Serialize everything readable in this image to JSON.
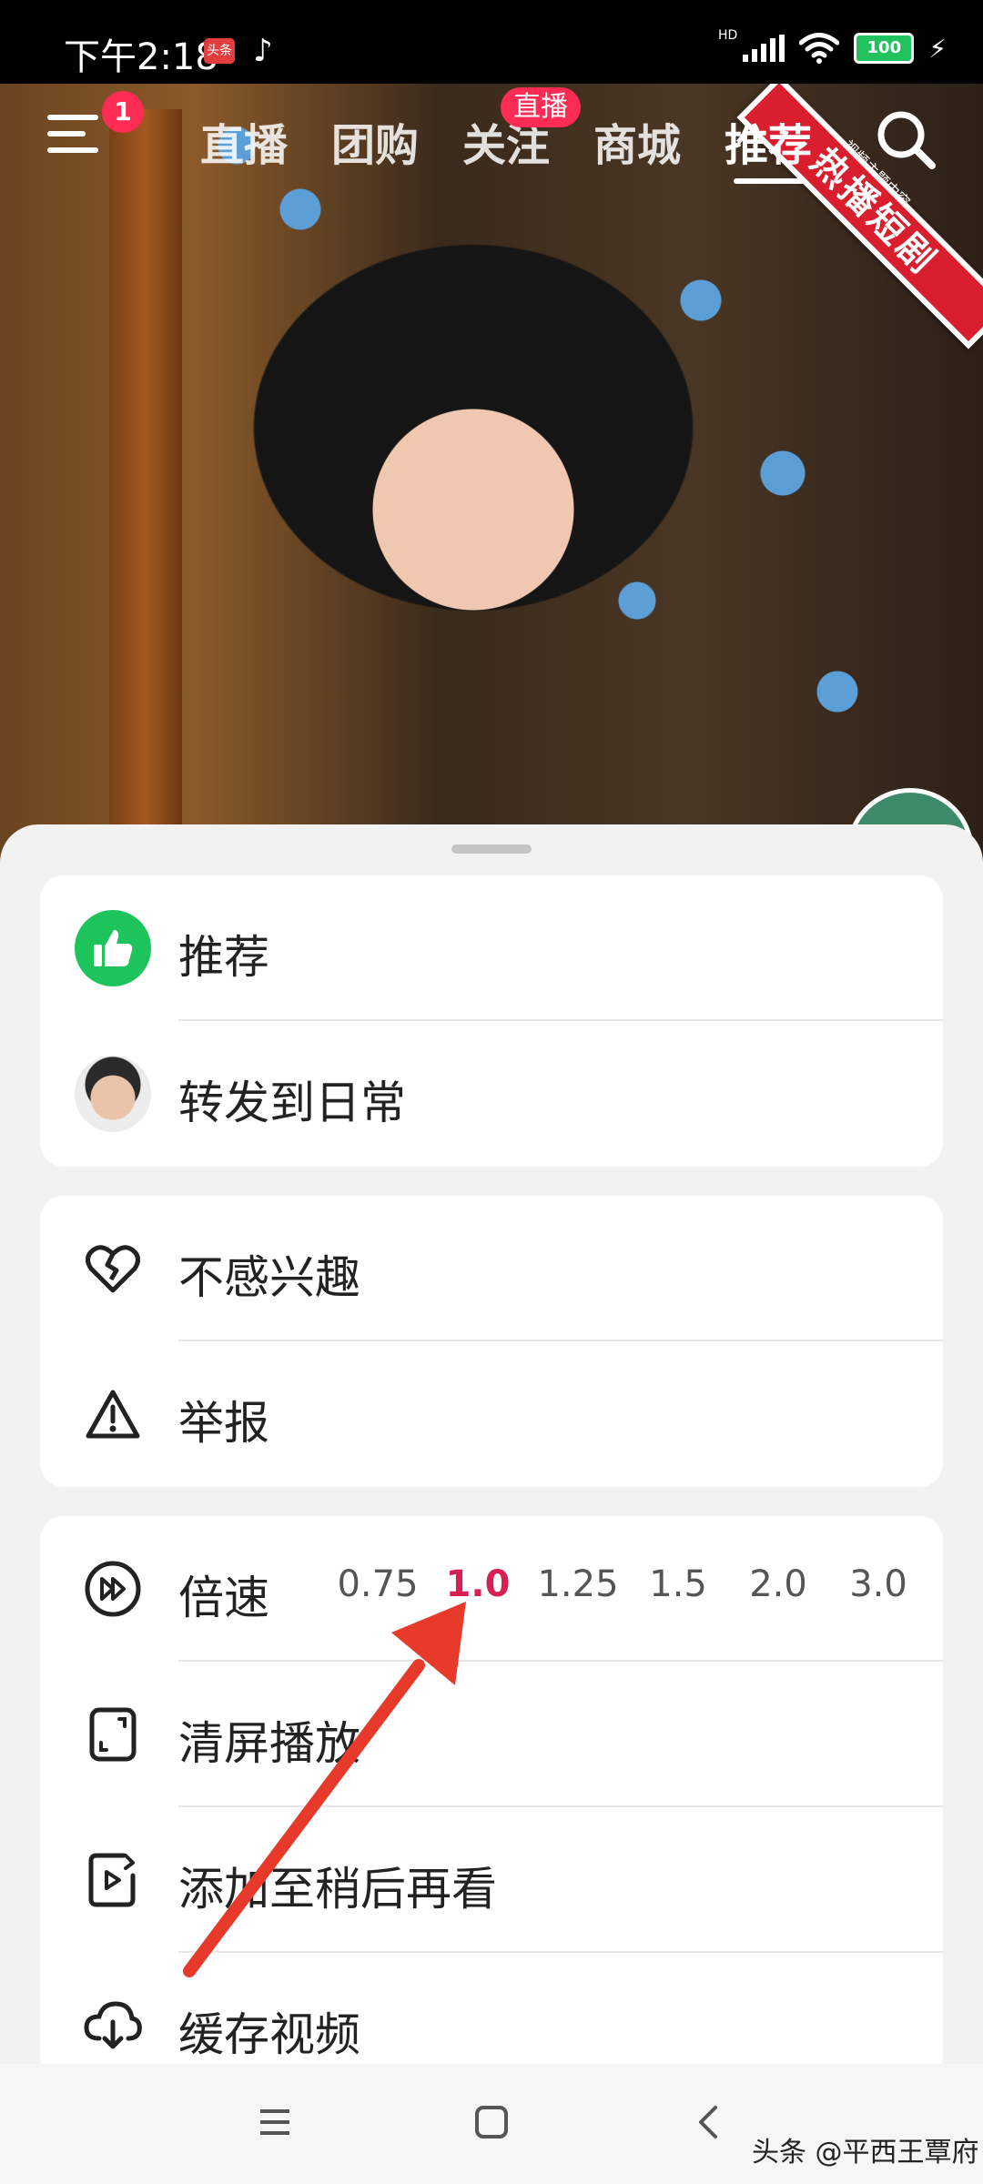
{
  "status_bar": {
    "time": "下午2:18",
    "app_badge": "头条",
    "network": "HD",
    "battery": "100"
  },
  "top_nav": {
    "notification_count": "1",
    "tabs": [
      {
        "label": "直播"
      },
      {
        "label": "团购"
      },
      {
        "label": "关注"
      },
      {
        "label": "商城"
      },
      {
        "label": "推荐"
      }
    ],
    "active_tab": "推荐",
    "live_badge": "直播"
  },
  "video": {
    "ribbon_text": "热播短剧",
    "ribbon_subtext": "- 视频主题内容 -"
  },
  "sheet": {
    "group1": [
      {
        "label": "推荐",
        "icon": "thumbs-up-icon"
      },
      {
        "label": "转发到日常",
        "icon": "avatar"
      }
    ],
    "group2": [
      {
        "label": "不感兴趣",
        "icon": "broken-heart-icon"
      },
      {
        "label": "举报",
        "icon": "warning-icon"
      }
    ],
    "group3": {
      "speed_label": "倍速",
      "speeds": [
        "0.75",
        "1.0",
        "1.25",
        "1.5",
        "2.0",
        "3.0"
      ],
      "selected_speed": "1.0",
      "items": [
        {
          "label": "清屏播放",
          "icon": "clear-screen-icon"
        },
        {
          "label": "添加至稍后再看",
          "icon": "watch-later-icon"
        },
        {
          "label": "缓存视频",
          "icon": "download-cloud-icon"
        }
      ]
    }
  },
  "colors": {
    "accent_pink": "#fe2c55",
    "selected_speed": "#d91e53",
    "green": "#1dc35b",
    "arrow_red": "#e83a2a"
  },
  "watermark": "头条 @平西王覃府"
}
